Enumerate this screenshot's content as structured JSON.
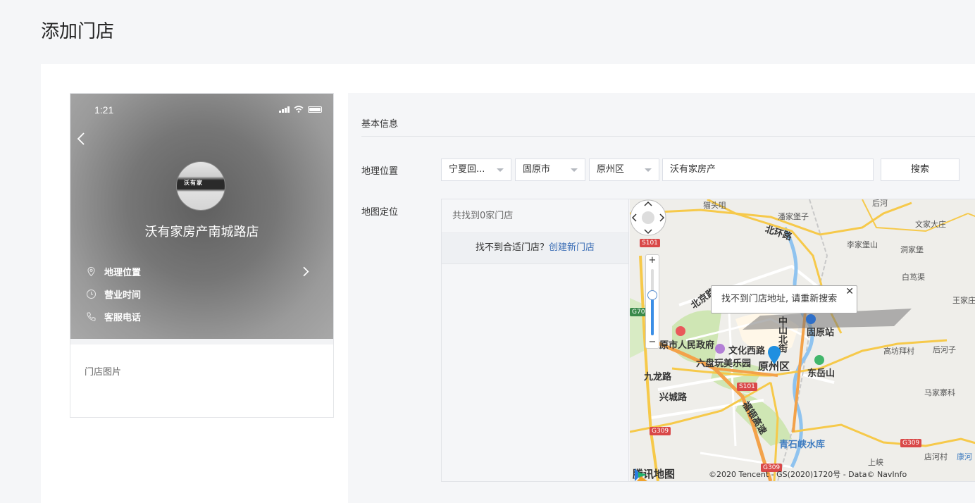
{
  "page": {
    "title": "添加门店"
  },
  "preview": {
    "status_time": "1:21",
    "store_name": "沃有家房产南城路店",
    "avatar_text": "沃有家",
    "info_items": [
      {
        "icon": "location-pin-icon",
        "label": "地理位置"
      },
      {
        "icon": "clock-icon",
        "label": "营业时间"
      },
      {
        "icon": "phone-icon",
        "label": "客服电话"
      }
    ],
    "store_pic_label": "门店图片"
  },
  "form": {
    "section_title": "基本信息",
    "geo_label": "地理位置",
    "map_label": "地图定位",
    "province": "宁夏回...",
    "city": "固原市",
    "district": "原州区",
    "address_value": "沃有家房产",
    "search_label": "搜索"
  },
  "map": {
    "result_count": "共找到0家门店",
    "hint_text": "找不到合适门店？",
    "hint_link": "创建新门店",
    "popup_text": "找不到门店地址, 请重新搜索",
    "popup_close": "✕",
    "zoom_plus": "+",
    "zoom_minus": "−",
    "brand": "腾讯地图",
    "copyright": "©2020 Tencent - GS(2020)1720号 - Data© NavInfo",
    "labels": {
      "l1": "猫头咀",
      "l2": "潘家堡子",
      "l3": "后河",
      "l4": "北环路",
      "l5": "文家大庄",
      "l6": "李家堡山",
      "l7": "洞家堡",
      "l8": "白茑渠",
      "l9": "王家庄",
      "l10": "北京路",
      "l11": "中山北街",
      "l12": "固原站",
      "l13": "原市人民政府",
      "l14": "文化西路",
      "l15": "六盘玩美乐园",
      "l16": "原州区",
      "l17": "东岳山",
      "l18": "高坊拜村",
      "l19": "后河子",
      "l20": "九龙路",
      "l21": "兴城路",
      "l22": "马家寨科",
      "l23": "福银高速",
      "l24": "青石峡水库",
      "l25": "上峡",
      "l26": "店河村",
      "l27": "康河"
    },
    "badges": {
      "s101a": "S101",
      "s101b": "S101",
      "g70": "G70",
      "g309a": "G309",
      "g309b": "G309",
      "g309c": "G309"
    }
  },
  "colors": {
    "link": "#3d6fb6",
    "zoom_blue": "#3a8ee6",
    "pin_blue": "#1f8fe0",
    "road_yellow": "#f6c94a",
    "road_orange": "#f3a24a"
  }
}
